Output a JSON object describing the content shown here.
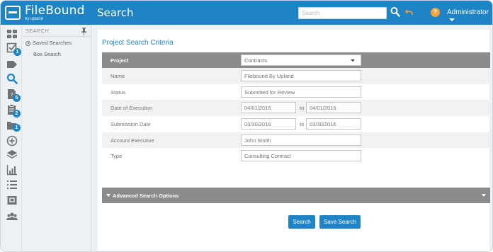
{
  "brand": {
    "name": "FileBound",
    "sub": "by upland"
  },
  "header": {
    "title": "Search",
    "search_placeholder": "Search",
    "user": "Administrator",
    "help": "?",
    "accent": "#1e84c6"
  },
  "rail": {
    "badges": {
      "checkbox": "1",
      "review": "5",
      "tasks": "2",
      "folders": "1"
    }
  },
  "panel": {
    "heading": "SEARCH",
    "items": [
      "Saved Searches",
      "Box Search"
    ]
  },
  "criteria": {
    "title": "Project Search Criteria",
    "project_label": "Project",
    "project_value": "Contracts",
    "rows": [
      {
        "label": "Name",
        "value": "Filebound By Upland"
      },
      {
        "label": "Status",
        "value": "Submitted for Review"
      },
      {
        "label": "Date of Execution",
        "from": "04/01/2016",
        "to_label": "to",
        "to": "04/01/2016"
      },
      {
        "label": "Submission Date",
        "from": "03/30/2016",
        "to_label": "to",
        "to": "03/30/2016"
      },
      {
        "label": "Account Executive",
        "value": "John Smith"
      },
      {
        "label": "Type",
        "value": "Consulting Contract"
      }
    ],
    "advanced_label": "Advanced Search Options",
    "search_button": "Search",
    "save_button": "Save Search"
  }
}
